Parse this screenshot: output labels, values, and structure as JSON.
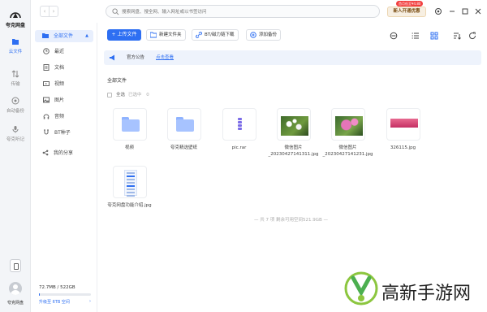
{
  "app": {
    "name": "夸克网盘"
  },
  "rail": {
    "items": [
      {
        "label": "云文件",
        "icon": "cloud-file-icon",
        "active": true
      },
      {
        "label": "传输",
        "icon": "transfer-icon"
      },
      {
        "label": "自动备份",
        "icon": "backup-icon"
      },
      {
        "label": "夸克听记",
        "icon": "voice-note-icon"
      }
    ],
    "user_name": "夸克网盘"
  },
  "topbar": {
    "back": "‹",
    "forward": "›",
    "search_placeholder": "搜索网盘、搜全网、输入网址或以书签访问",
    "promo_label": "新人开通优惠",
    "promo_badge": "首月低至¥4.80"
  },
  "sidebar": {
    "items": [
      {
        "label": "全部文件",
        "icon": "folder-icon",
        "active": true,
        "caret": "▲"
      },
      {
        "label": "最近",
        "icon": "clock-icon"
      },
      {
        "label": "文档",
        "icon": "document-icon"
      },
      {
        "label": "视频",
        "icon": "video-icon"
      },
      {
        "label": "图片",
        "icon": "image-icon"
      },
      {
        "label": "音频",
        "icon": "audio-icon"
      },
      {
        "label": "BT种子",
        "icon": "bt-icon"
      },
      {
        "label": "我的分享",
        "icon": "share-icon"
      }
    ],
    "storage_text": "72.7MB / 522GB",
    "storage_fraction": 0.0002,
    "upgrade_text": "升级至 6TB 空间",
    "upgrade_arrow": "›"
  },
  "toolbar": {
    "upload_label": "上传文件",
    "new_folder_label": "新建文件夹",
    "bt_label": "BT/磁力链下载",
    "add_backup_label": "添加备份"
  },
  "notice": {
    "text": "官方公告",
    "link": "点击查看"
  },
  "breadcrumb": "全部文件",
  "select": {
    "label": "全选",
    "selected_text": "已选中",
    "selected_count": "0"
  },
  "files": [
    {
      "name": "视频",
      "type": "folder"
    },
    {
      "name": "夸克精选壁纸",
      "type": "folder"
    },
    {
      "name": "pic.rar",
      "type": "rar"
    },
    {
      "name": "微信图片_20230427141311.jpg",
      "type": "image1"
    },
    {
      "name": "微信图片_20230427141231.jpg",
      "type": "image2"
    },
    {
      "name": "326115.jpg",
      "type": "image3"
    },
    {
      "name": "夸克网盘功能介绍.jpg",
      "type": "doc"
    }
  ],
  "footer_count": "— 共 7 项 剩余可用空间521.9GB —",
  "watermark": {
    "text": "高新手游网"
  },
  "colors": {
    "accent": "#2e6ff2",
    "promo_bg": "#f7efe2",
    "badge": "#f23f3f"
  }
}
